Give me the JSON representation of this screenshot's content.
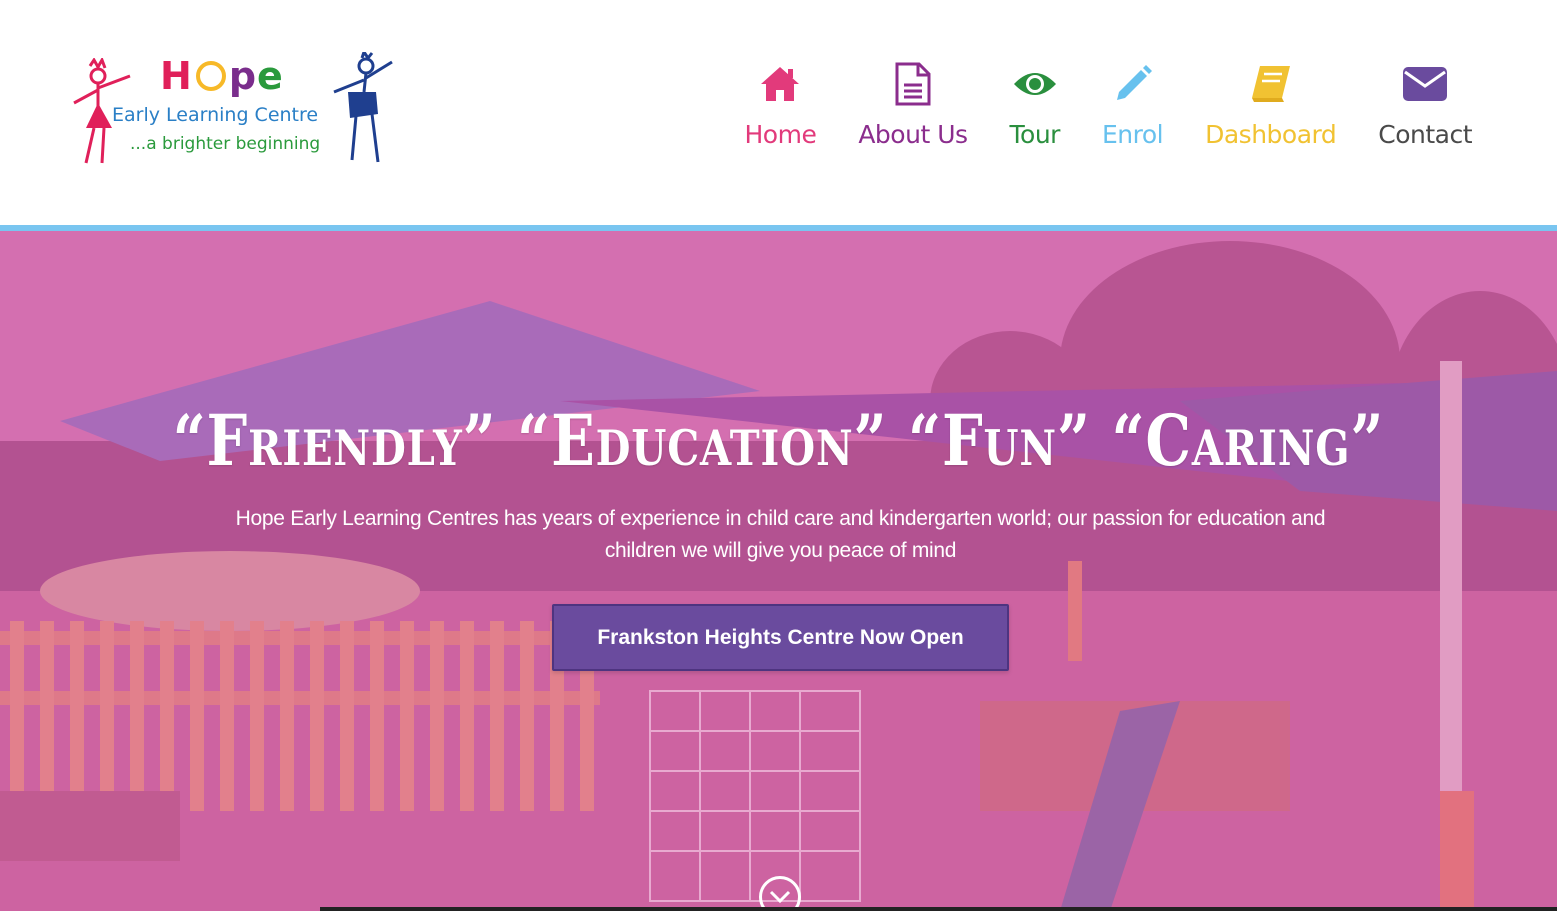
{
  "logo": {
    "word": "Hope",
    "subtitle": "Early Learning Centre",
    "tagline": "...a brighter beginning"
  },
  "nav": {
    "items": [
      {
        "label": "Home",
        "icon": "home-icon",
        "color": "#e23a7b"
      },
      {
        "label": "About Us",
        "icon": "document-icon",
        "color": "#8b2d8d"
      },
      {
        "label": "Tour",
        "icon": "eye-icon",
        "color": "#2a8f3e"
      },
      {
        "label": "Enrol",
        "icon": "pencil-icon",
        "color": "#67c1ee"
      },
      {
        "label": "Dashboard",
        "icon": "book-icon",
        "color": "#f1c232"
      },
      {
        "label": "Contact",
        "icon": "envelope-icon",
        "color": "#6a4b9e"
      }
    ]
  },
  "hero": {
    "headline": "“Friendly” “Education” “Fun” “Caring”",
    "subtext": "Hope Early Learning Centres has years of experience in child care and kindergarten world;  our passion for education and children we will give you peace of mind",
    "cta_label": "Frankston Heights Centre Now Open",
    "scroll_icon": "chevron-down-circle-icon"
  },
  "colors": {
    "accent_bar": "#79c5f0",
    "overlay": "#d95aa5",
    "cta": "#6a4b9e",
    "contact_label": "#4a4a4a"
  }
}
